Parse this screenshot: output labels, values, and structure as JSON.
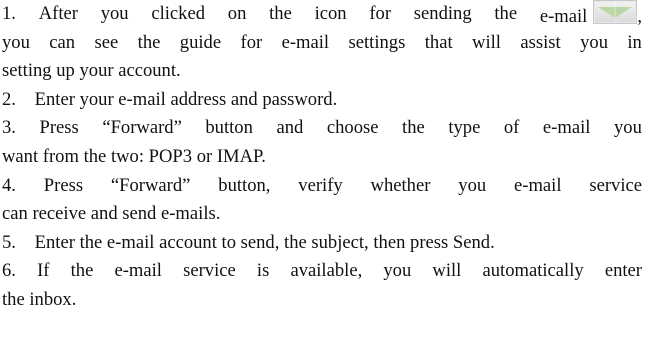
{
  "steps": [
    {
      "num": "1.",
      "lines": [
        [
          "After",
          "you",
          "clicked",
          "on",
          "the",
          "icon",
          "for",
          "sending",
          "the",
          "e-mail"
        ],
        [
          "you",
          "can",
          "see",
          "the",
          "guide",
          "for",
          "e-mail",
          "settings",
          "that",
          "will",
          "assist",
          "you",
          "in"
        ],
        [
          "setting up your account."
        ]
      ],
      "after_icon": ","
    },
    {
      "num": "2.",
      "text": "Enter your e-mail address and password."
    },
    {
      "num": "3.",
      "lines": [
        [
          "Press",
          "“Forward”",
          "button",
          "and",
          "choose",
          "the",
          "type",
          "of",
          "e-mail",
          "you"
        ],
        [
          "want from the two: POP3 or IMAP."
        ]
      ]
    },
    {
      "num": "4.",
      "lines": [
        [
          "Press",
          "“Forward”",
          "button,",
          "verify",
          "whether",
          "you",
          "e-mail",
          "service"
        ],
        [
          "can receive and send e-mails."
        ]
      ]
    },
    {
      "num": "5.",
      "text": "Enter the e-mail account to send, the subject, then press Send."
    },
    {
      "num": "6.",
      "lines": [
        [
          "If",
          "the",
          "e-mail",
          "service",
          "is",
          "available,",
          "you",
          "will",
          "automatically",
          "enter"
        ],
        [
          "the inbox."
        ]
      ]
    }
  ],
  "icons": {
    "mail": "envelope-icon"
  }
}
